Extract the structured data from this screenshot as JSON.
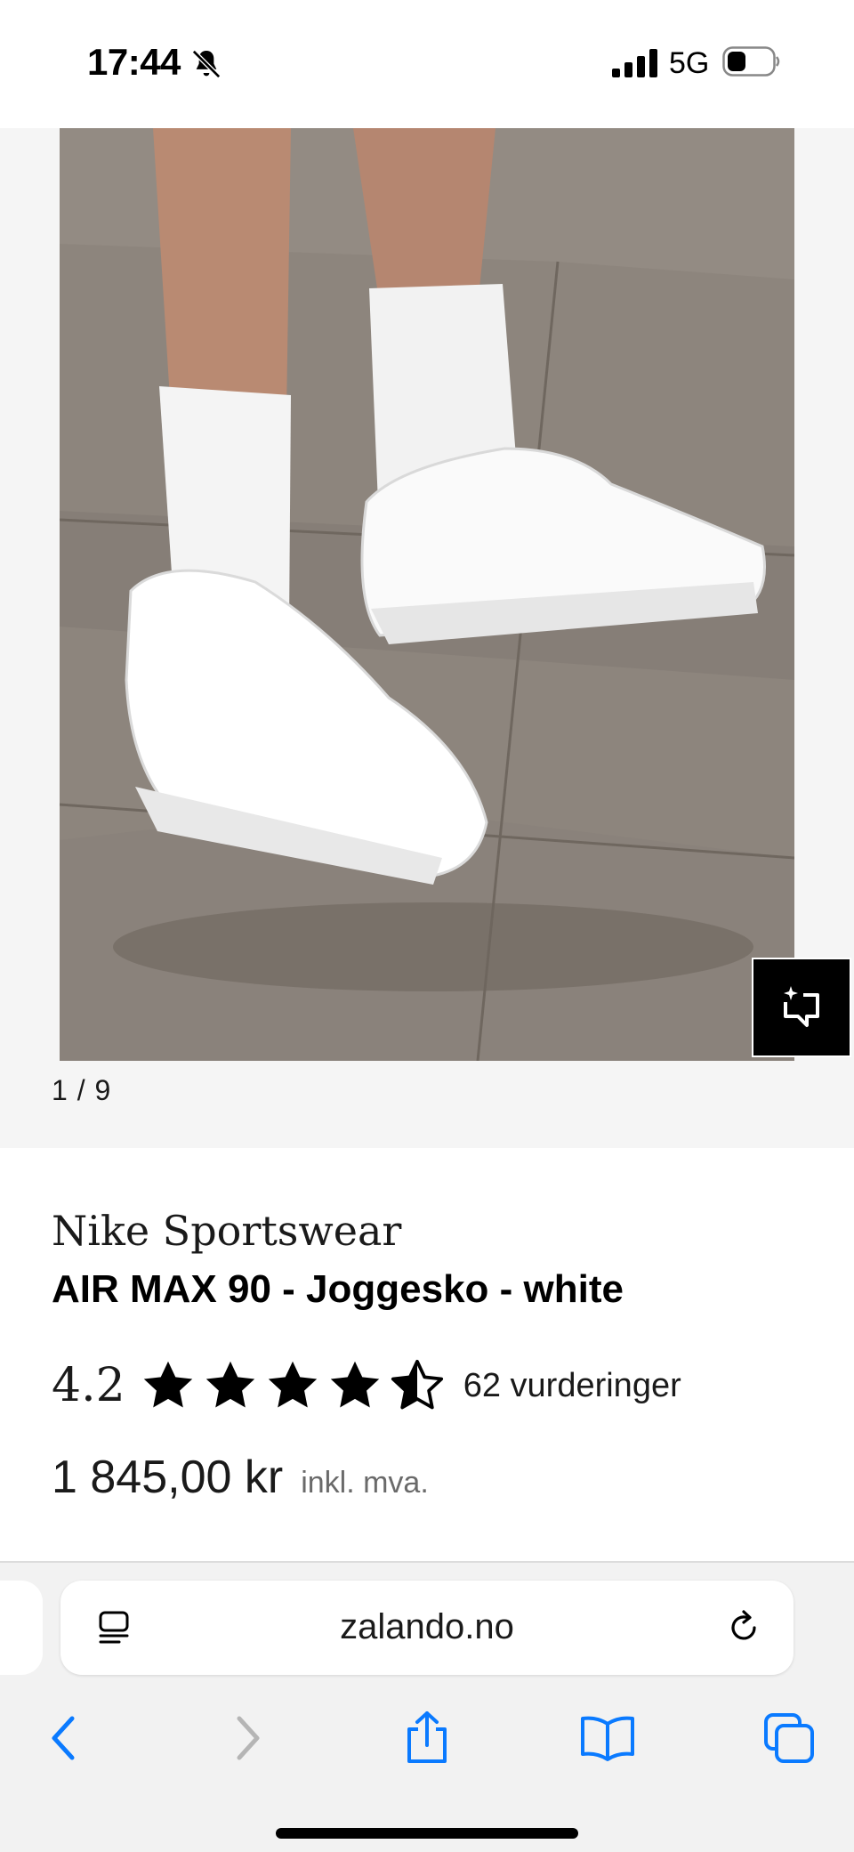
{
  "status_bar": {
    "time": "17:44",
    "network": "5G"
  },
  "gallery": {
    "counter": "1 / 9"
  },
  "product": {
    "brand": "Nike Sportswear",
    "name": "AIR MAX 90 - Joggesko - white",
    "rating": "4.2",
    "rating_value": 4.2,
    "rating_max": 5,
    "review_count": "62 vurderinger",
    "price": "1 845,00 kr",
    "tax_note": "inkl. mva."
  },
  "browser": {
    "url": "zalando.no"
  },
  "icons": {
    "bell": "bell-slash-icon",
    "visual_search": "visual-search-icon",
    "reader": "reader-icon",
    "reload": "reload-icon",
    "back": "chevron-left-icon",
    "forward": "chevron-right-icon",
    "share": "share-icon",
    "bookmarks": "book-icon",
    "tabs": "tabs-icon"
  },
  "colors": {
    "accent": "#0a7aff",
    "disabled": "#b5b5b5",
    "text": "#1a1a1a",
    "muted": "#6a6a6a"
  }
}
